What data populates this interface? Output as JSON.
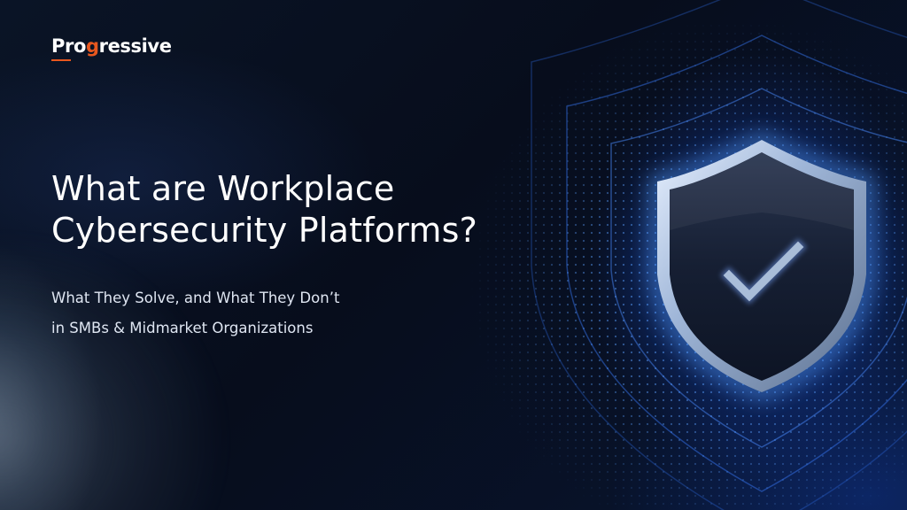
{
  "brand": {
    "logo_text_before": "Pro",
    "logo_text_accent": "g",
    "logo_text_after": "ressive",
    "accent_color": "#e8571e"
  },
  "hero": {
    "headline_line1": "What are Workplace",
    "headline_line2": "Cybersecurity Platforms?",
    "subtitle_line1": "What They Solve, and What They Don’t",
    "subtitle_line2": "in SMBs & Midmarket Organizations"
  },
  "visual": {
    "icon": "shield-check-icon",
    "glow_color": "#2f7bff",
    "background_color": "#07101f"
  }
}
